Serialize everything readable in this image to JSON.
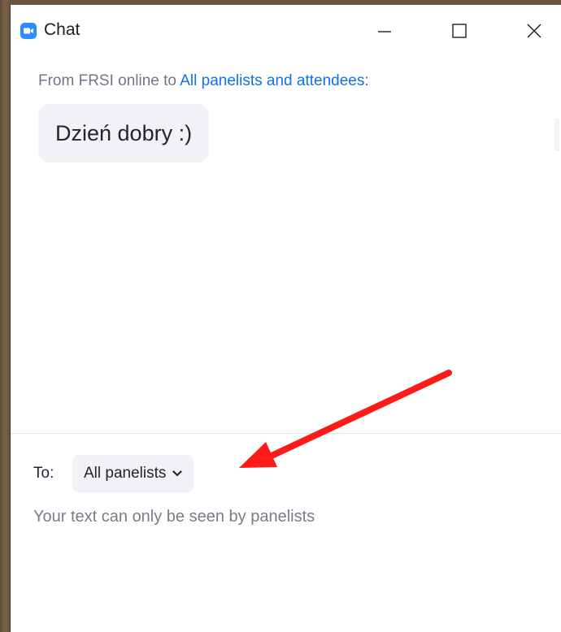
{
  "window": {
    "title": "Chat",
    "icon": "zoom-camera-icon",
    "controls": [
      "minimize-icon",
      "maximize-icon",
      "close-icon"
    ]
  },
  "message": {
    "from_prefix": "From FRSI online to ",
    "recipients": "All panelists and attendees:",
    "text": "Dzień dobry :)"
  },
  "composer": {
    "to_label": "To:",
    "to_value": "All panelists",
    "hint": "Your text can only be seen by panelists"
  },
  "colors": {
    "accent": "#0e71eb",
    "app_icon": "#2d8cff",
    "bubble": "#f1f1f6",
    "annotation_arrow": "#ff1a1a"
  }
}
